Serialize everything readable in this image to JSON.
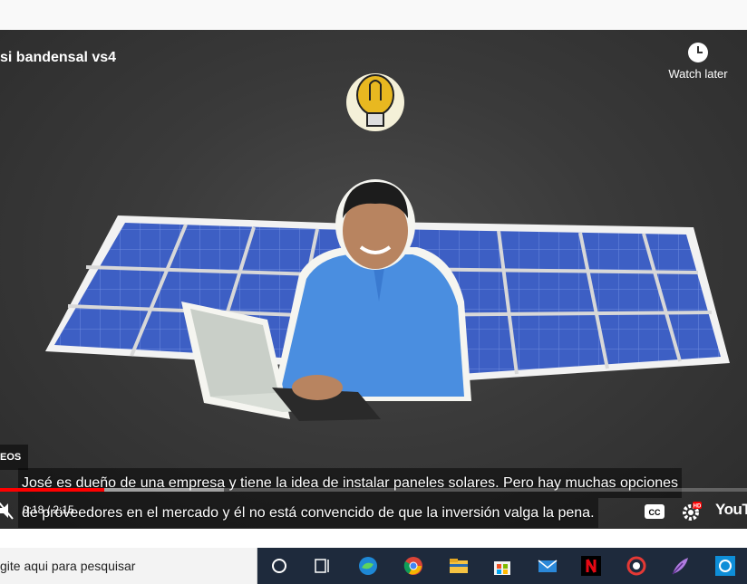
{
  "video": {
    "title": "si bandensal vs4",
    "watch_later_label": "Watch later",
    "badge_text": "EOS",
    "captions": [
      "José es dueño de una empresa y tiene la idea de instalar paneles solares. Pero hay muchas opciones",
      "de proveedores en el mercado y él no está convencido de que la inversión valga la pena."
    ],
    "time_display": "0:18 / 2:15",
    "progress_fraction": 0.14,
    "buffer_fraction": 0.3,
    "hd_badge": "HD",
    "logo_text": "YouTu"
  },
  "colors": {
    "progress": "#ff0000",
    "taskbar": "#1e2a3c",
    "panel_blue": "#3d5fc4"
  },
  "taskbar": {
    "search_placeholder": "gite aqui para pesquisar",
    "icons": [
      "cortana-icon",
      "task-view-icon",
      "edge-icon",
      "chrome-icon",
      "file-explorer-icon",
      "store-icon",
      "mail-icon",
      "netflix-icon",
      "app-red-icon",
      "feather-icon",
      "app-blue-icon"
    ]
  }
}
